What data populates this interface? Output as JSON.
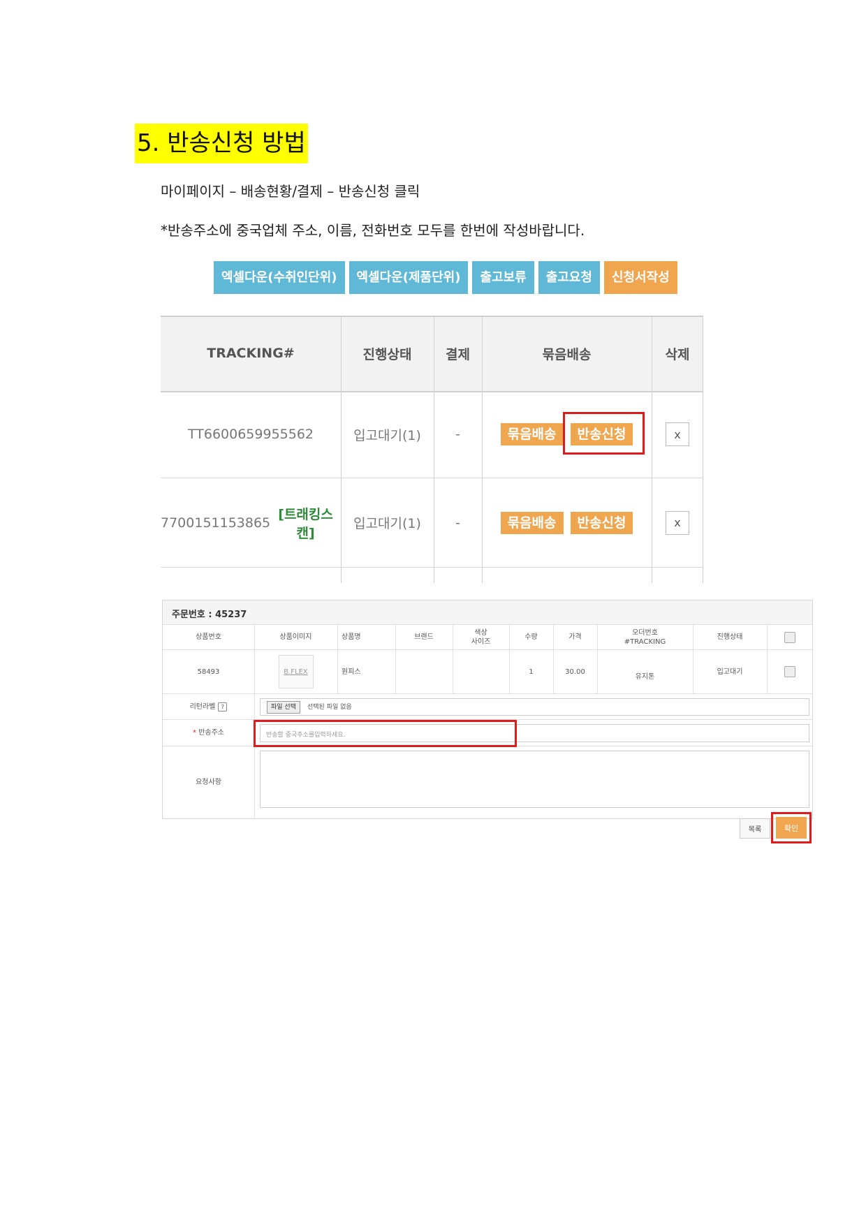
{
  "heading": "5. 반송신청 방법",
  "line1": "마이페이지 – 배송현황/결제 – 반송신청 클릭",
  "line2": "*반송주소에 중국업체 주소, 이름, 전화번호 모두를 한번에 작성바랍니다.",
  "top_buttons": {
    "excel_recipient": "엑셀다운(수취인단위)",
    "excel_product": "엑셀다운(제품단위)",
    "hold_release": "출고보류",
    "request_release": "출고요청",
    "write_application": "신청서작성"
  },
  "colors": {
    "blue_button": "#5fb8d6",
    "orange_button": "#f0a54f",
    "highlight": "#ffff00",
    "red_frame": "#e01b1b"
  },
  "tracking_table": {
    "headers": {
      "tracking": "TRACKING#",
      "status": "진행상태",
      "payment": "결제",
      "bundle": "묶음배송",
      "delete": "삭제"
    },
    "rows": [
      {
        "tracking": "TT6600659955562",
        "scan_label": "",
        "status": "입고대기(1)",
        "payment": "-",
        "bundle_btn": "묶음배송",
        "return_btn": "반송신청",
        "delete": "x"
      },
      {
        "tracking": "7700151153865",
        "scan_label": "[트래킹스캔]",
        "status": "입고대기(1)",
        "payment": "-",
        "bundle_btn": "묶음배송",
        "return_btn": "반송신청",
        "delete": "x"
      }
    ]
  },
  "order_form": {
    "order_label": "주문번호 : 45237",
    "headers": {
      "product_no": "상품번호",
      "product_image": "상품이미지",
      "product_name": "상품명",
      "brand": "브랜드",
      "color": "색상",
      "size": "사이즈",
      "qty": "수량",
      "price": "가격",
      "order_no": "오더번호",
      "tracking": "#TRACKING",
      "status": "진행상태"
    },
    "row": {
      "product_no": "58493",
      "image_text": "B.FLEX",
      "product_name": "원피스",
      "brand": "",
      "color_size": "",
      "qty": "1",
      "price": "30.00",
      "order_tracking": "유지톤",
      "status": "입고대기"
    },
    "return_label_label": "리턴라벨",
    "help_icon": "?",
    "file_button": "파일 선택",
    "file_status": "선택된 파일 없음",
    "return_address_label": "반송주소",
    "required_mark": "*",
    "return_address_placeholder": "반송할 중국주소를입력하세요.",
    "request_label": "요청사항",
    "request_value": ""
  },
  "bottom_buttons": {
    "list": "목록",
    "confirm": "확인"
  }
}
